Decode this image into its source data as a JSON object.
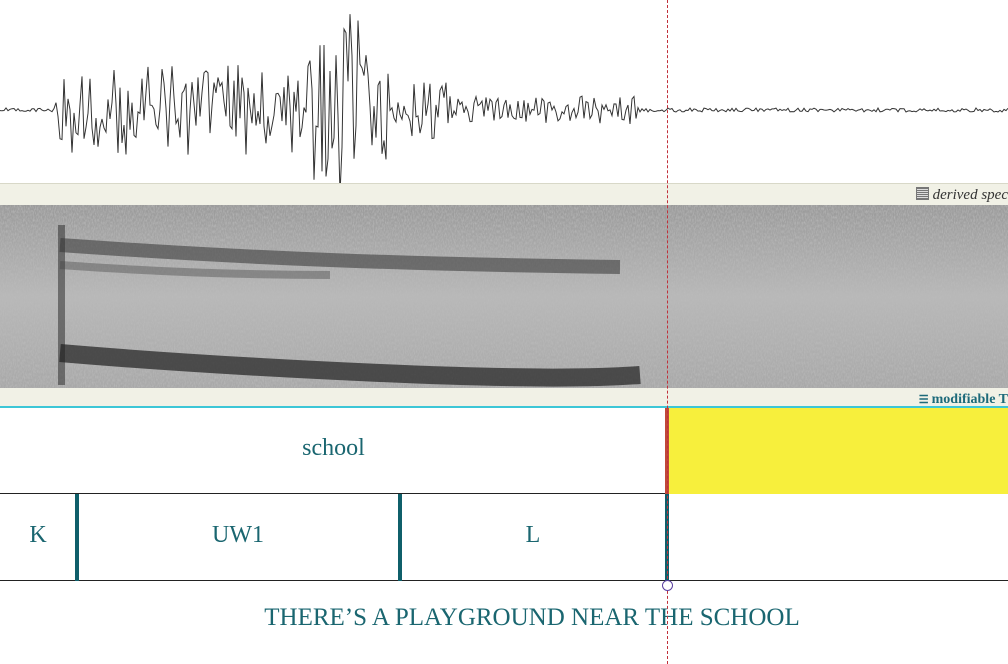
{
  "panels": {
    "spectrogram_label": "derived spec",
    "tier_label": "modifiable T"
  },
  "word_tier": {
    "word": "school"
  },
  "phone_tier": {
    "k": "K",
    "uw1": "UW1",
    "l": "L"
  },
  "sentence": "THERE’S A PLAYGROUND NEAR THE SCHOOL",
  "colors": {
    "label_teal": "#1a6670",
    "selection_yellow": "#f7ef3c",
    "cursor_red": "#c0303a",
    "tier_border": "#3cc6d6"
  }
}
